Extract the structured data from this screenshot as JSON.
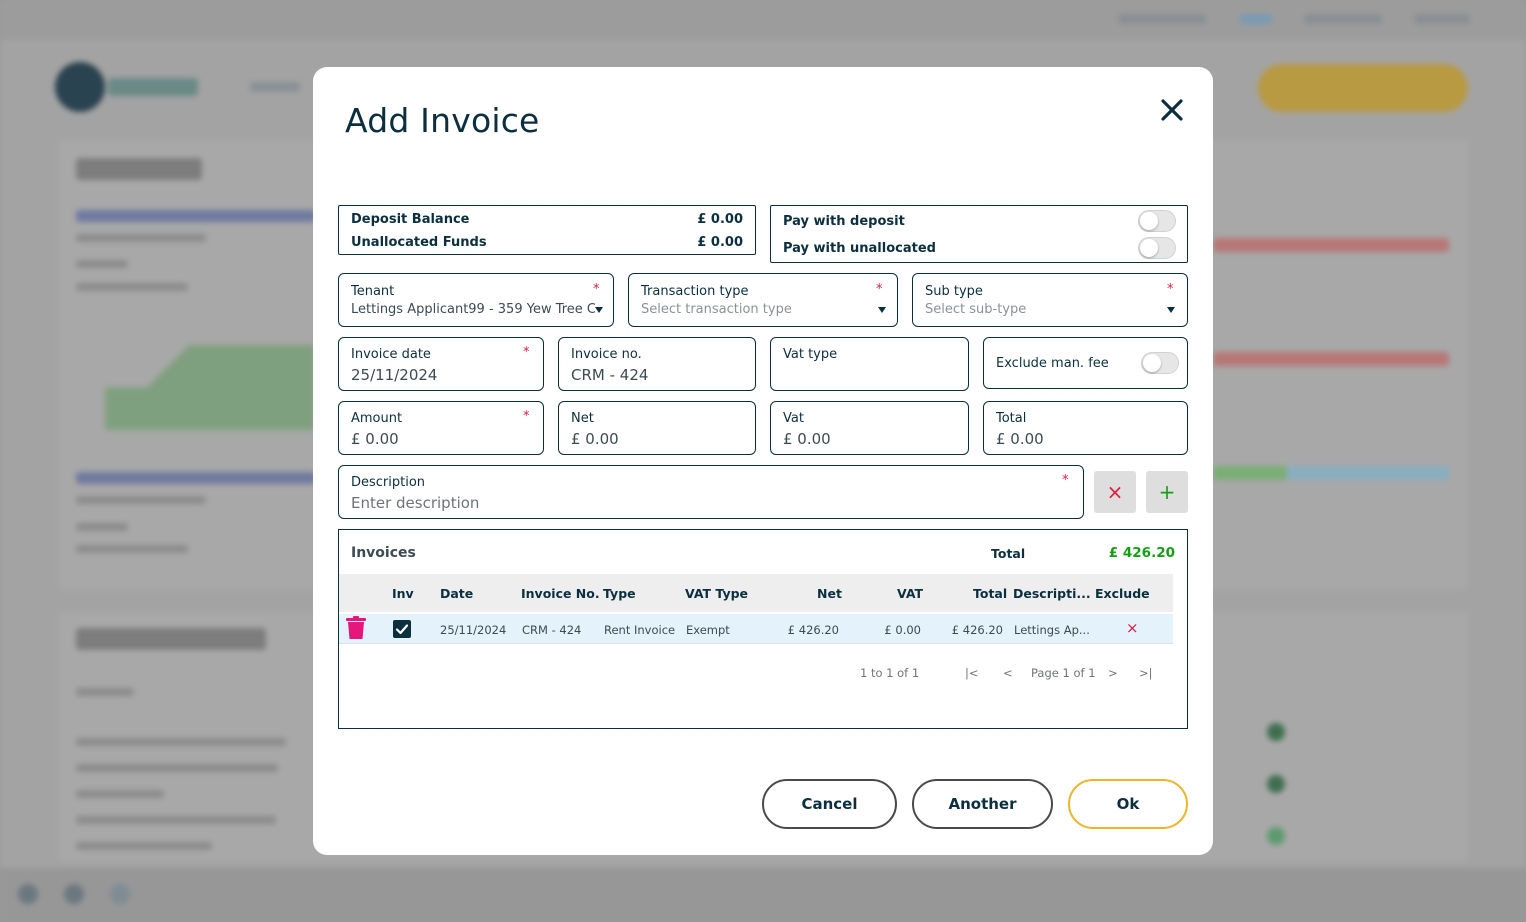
{
  "modal": {
    "title": "Add Invoice"
  },
  "balances": {
    "deposit_label": "Deposit Balance",
    "deposit_value": "£ 0.00",
    "unallocated_label": "Unallocated Funds",
    "unallocated_value": "£ 0.00"
  },
  "pay_options": {
    "pay_with_deposit_label": "Pay with deposit",
    "pay_with_deposit_on": false,
    "pay_with_unallocated_label": "Pay with unallocated",
    "pay_with_unallocated_on": false
  },
  "fields": {
    "tenant": {
      "label": "Tenant",
      "value": "Lettings Applicant99 - 359 Yew Tree C"
    },
    "transaction_type": {
      "label": "Transaction type",
      "placeholder": "Select transaction type"
    },
    "sub_type": {
      "label": "Sub type",
      "placeholder": "Select sub-type"
    },
    "invoice_date": {
      "label": "Invoice date",
      "value": "25/11/2024"
    },
    "invoice_no": {
      "label": "Invoice no.",
      "value": "CRM - 424"
    },
    "vat_type": {
      "label": "Vat type",
      "value": ""
    },
    "exclude_man_fee": {
      "label": "Exclude man. fee",
      "on": false
    },
    "amount": {
      "label": "Amount",
      "value": "£ 0.00"
    },
    "net": {
      "label": "Net",
      "value": "£ 0.00"
    },
    "vat": {
      "label": "Vat",
      "value": "£ 0.00"
    },
    "total": {
      "label": "Total",
      "value": "£ 0.00"
    },
    "description": {
      "label": "Description",
      "placeholder": "Enter description"
    },
    "required_marker": "*"
  },
  "buttons": {
    "clear_icon": "×",
    "add_icon": "+",
    "cancel": "Cancel",
    "another": "Another",
    "ok": "Ok"
  },
  "invoices": {
    "title": "Invoices",
    "total_label": "Total",
    "total_value": "£ 426.20",
    "columns": [
      "Inv",
      "Date",
      "Invoice No.",
      "Type",
      "VAT Type",
      "Net",
      "VAT",
      "Total",
      "Descripti...",
      "Exclude"
    ],
    "rows": [
      {
        "checked": true,
        "date": "25/11/2024",
        "invoice_no": "CRM - 424",
        "type": "Rent Invoice",
        "vat_type": "Exempt",
        "net": "£ 426.20",
        "vat": "£ 0.00",
        "total": "£ 426.20",
        "description": "Lettings Ap...",
        "exclude_icon": "×"
      }
    ],
    "pagination": {
      "range": "1 to 1 of 1",
      "page": "Page 1 of 1",
      "first_icon": "|<",
      "prev_icon": "<",
      "next_icon": ">",
      "last_icon": ">|"
    }
  },
  "colors": {
    "primary": "#0b2f3f",
    "required": "#e01b3c",
    "total_green": "#12a012",
    "delete_pink": "#e6177a",
    "ok_border": "#f0b429",
    "row_highlight": "#e4f2fb"
  }
}
